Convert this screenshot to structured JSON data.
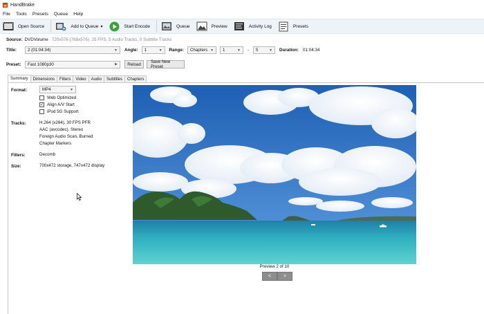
{
  "window": {
    "title": "HandBrake"
  },
  "menu": [
    "File",
    "Tools",
    "Presets",
    "Queue",
    "Help"
  ],
  "toolbar": {
    "open_source": "Open Source",
    "add_to_queue": "Add to Queue",
    "add_to_queue_caret": "▾",
    "start_encode": "Start Encode",
    "queue": "Queue",
    "preview": "Preview",
    "activity_log": "Activity Log",
    "presets": "Presets"
  },
  "source": {
    "label": "Source:",
    "name": "DVDVolume",
    "details": "720x576 (768x576), 25 FPS, 5 Audio Tracks, 0 Subtitle Tracks"
  },
  "title_row": {
    "title_label": "Title:",
    "title_value": "2 (01:04:34)",
    "angle_label": "Angle:",
    "angle_value": "1",
    "range_label": "Range:",
    "range_type": "Chapters",
    "range_start": "1",
    "range_dash": "-",
    "range_end": "5",
    "duration_label": "Duration:",
    "duration_value": "01:04:34"
  },
  "presets_row": {
    "label": "Preset:",
    "value": "Fast 1080p30",
    "reload": "Reload",
    "save_new": "Save New Preset"
  },
  "tabs": [
    "Summary",
    "Dimensions",
    "Filters",
    "Video",
    "Audio",
    "Subtitles",
    "Chapters"
  ],
  "summary": {
    "format_label": "Format:",
    "format_value": "MP4",
    "web_optimized": "Web Optimized",
    "align_av": "Align A/V Start",
    "ipod": "iPod 5G Support",
    "check_mark": "✓",
    "tracks_label": "Tracks:",
    "tracks": [
      "H.264 (x264), 30 FPS PFR",
      "AAC (avcodec), Stereo",
      "Foreign Audio Scan, Burned",
      "Chapter Markers"
    ],
    "filters_label": "Filters:",
    "filters_value": "Decomb",
    "size_label": "Size:",
    "size_value": "700x472 storage, 747x472 display"
  },
  "preview": {
    "caption": "Preview 2 of 10",
    "prev": "<",
    "next": ">"
  },
  "colors": {
    "sky": "#2f6fc0",
    "sea": "#2fb7c4",
    "start_green": "#3aa13a"
  }
}
